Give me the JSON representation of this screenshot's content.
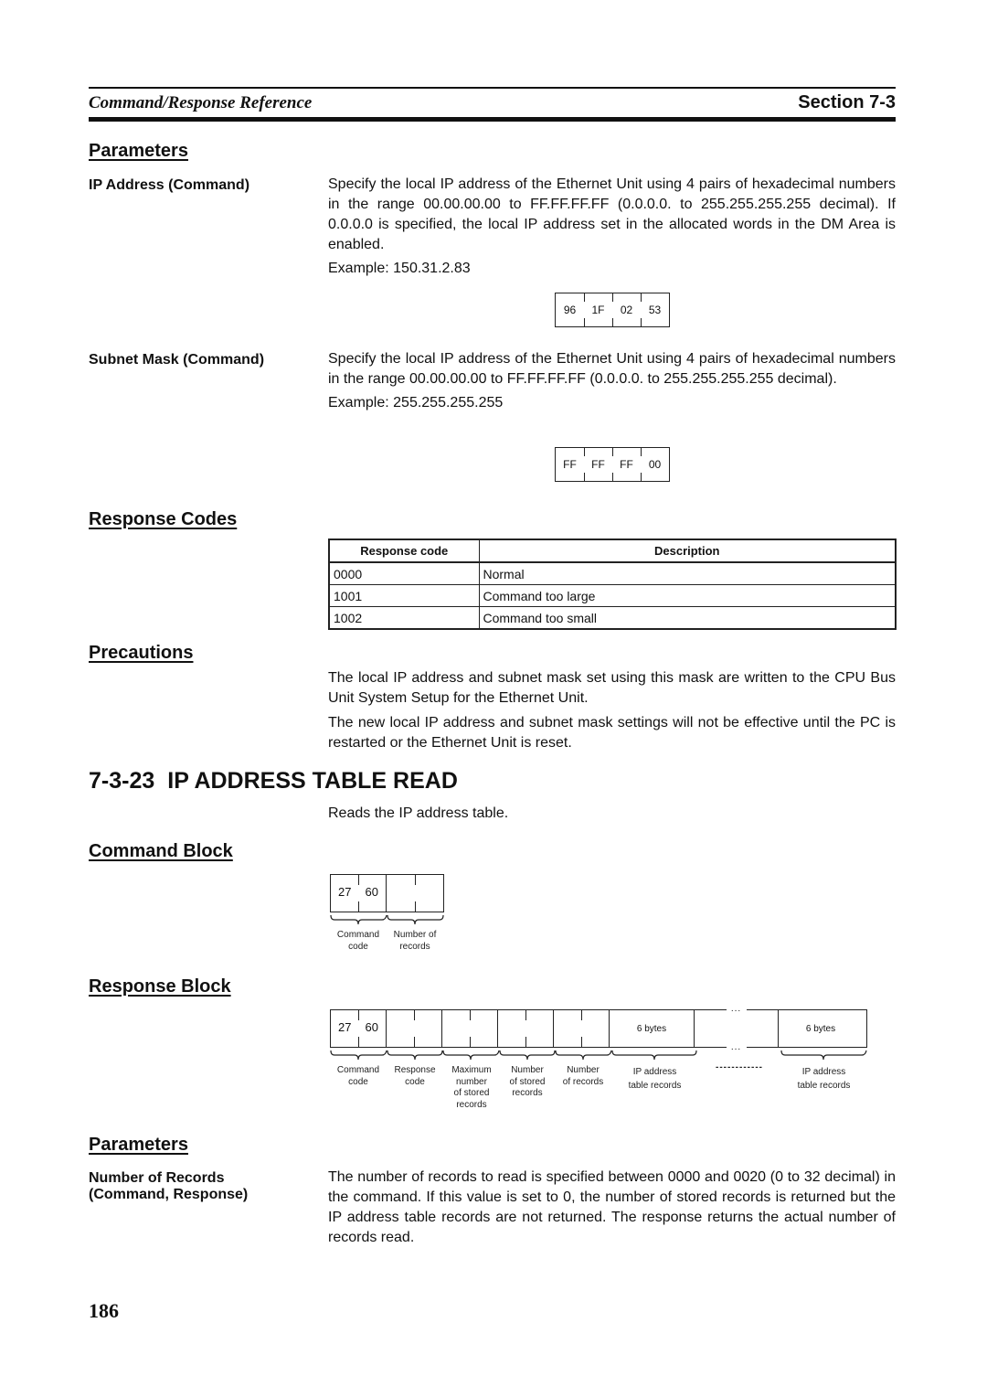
{
  "header": {
    "left": "Command/Response Reference",
    "right": "Section 7-3"
  },
  "sections": {
    "parameters1": "Parameters",
    "response_codes": "Response Codes",
    "precautions": "Precautions",
    "command_block": "Command Block",
    "response_block": "Response Block",
    "parameters2": "Parameters"
  },
  "ip_address": {
    "label": "IP Address (Command)",
    "text": "Specify the local IP address of the Ethernet Unit using 4 pairs of hexadecimal numbers in the range 00.00.00.00 to FF.FF.FF.FF (0.0.0.0. to 255.255.255.255 decimal). If 0.0.0.0 is specified, the local IP address set in the allocated words in the DM Area is enabled.",
    "example": "Example: 150.31.2.83",
    "bytes": [
      "96",
      "1F",
      "02",
      "53"
    ]
  },
  "subnet_mask": {
    "label": "Subnet Mask (Command)",
    "text": "Specify the local IP address of the Ethernet Unit using 4 pairs of hexadecimal numbers in the range 00.00.00.00 to FF.FF.FF.FF (0.0.0.0. to 255.255.255.255 decimal).",
    "example": "Example: 255.255.255.255",
    "bytes": [
      "FF",
      "FF",
      "FF",
      "00"
    ]
  },
  "response_table": {
    "columns": [
      "Response code",
      "Description"
    ],
    "rows": [
      {
        "code": "0000",
        "description": "Normal"
      },
      {
        "code": "1001",
        "description": "Command too large"
      },
      {
        "code": "1002",
        "description": "Command too small"
      }
    ]
  },
  "precautions": {
    "p1": "The local IP address and subnet mask set using this mask are written to the CPU Bus Unit System Setup for the Ethernet Unit.",
    "p2": "The new local IP address and subnet mask settings will not be effective until the PC is restarted or the Ethernet Unit is reset."
  },
  "title": {
    "number": "7-3-23",
    "text": "IP ADDRESS TABLE READ",
    "intro": "Reads the IP address table."
  },
  "command_block": {
    "code": [
      "27",
      "60"
    ],
    "labels": [
      "Command\ncode",
      "Number of\nrecords"
    ]
  },
  "response_block": {
    "code": [
      "27",
      "60"
    ],
    "six_bytes": "6 bytes",
    "labels": {
      "command_code": "Command\ncode",
      "response_code": "Response\ncode",
      "max_records": "Maximum\nnumber\nof stored\nrecords",
      "stored_records": "Number\nof stored\nrecords",
      "num_records": "Number\nof records",
      "ip_table_1": "IP address\ntable records",
      "dashes": "------------",
      "ip_table_2": "IP address\ntable records"
    },
    "ellipsis": "..."
  },
  "number_of_records": {
    "label": "Number of Records\n(Command, Response)",
    "text": "The number of records to read is specified between 0000 and 0020 (0 to 32 decimal) in the command. If this value is set to 0, the number of stored records is returned but the IP address table records are not returned. The response returns the actual number of records read."
  },
  "page_number": "186"
}
